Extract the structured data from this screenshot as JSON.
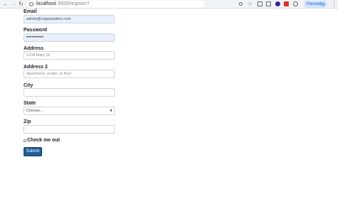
{
  "browser": {
    "url_host": "localhost",
    "url_path": ":3000/register?",
    "profile_label": "Paused"
  },
  "form": {
    "email": {
      "label": "Email",
      "value": "admin@organization.com"
    },
    "password": {
      "label": "Password",
      "value": "••••••••••"
    },
    "address": {
      "label": "Address",
      "placeholder": "1234 Main St"
    },
    "address2": {
      "label": "Address 2",
      "placeholder": "Apartment, studio, or floor"
    },
    "city": {
      "label": "City"
    },
    "state": {
      "label": "State",
      "selected": "Choose..."
    },
    "zip": {
      "label": "Zip"
    },
    "check": {
      "label": "Check me out"
    },
    "submit_label": "Submit"
  },
  "colors": {
    "submit_bg": "#1d5e96",
    "autofill_bg": "#e8f0fe"
  },
  "icons": [
    "back-arrow-icon",
    "forward-arrow-icon",
    "reload-icon",
    "info-icon",
    "key-icon",
    "star-icon",
    "extension-icon",
    "menu-icon"
  ]
}
